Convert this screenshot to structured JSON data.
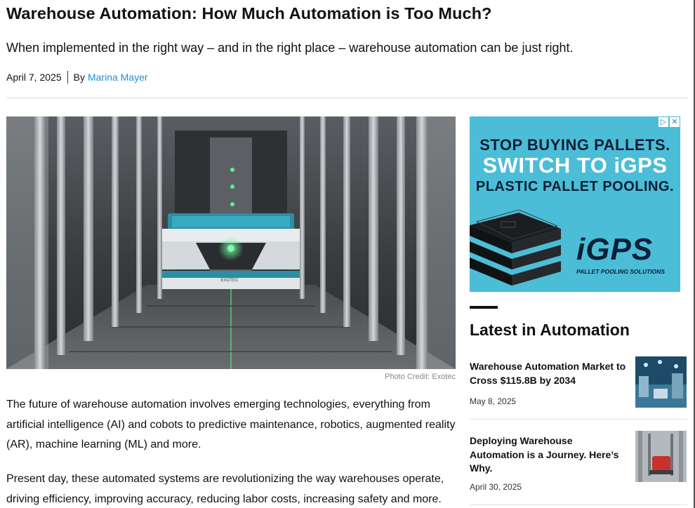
{
  "article": {
    "title": "Warehouse Automation: How Much Automation is Too Much?",
    "subtitle": "When implemented in the right way – and in the right place – warehouse automation can be just right.",
    "date": "April 7, 2025",
    "by_label": "By",
    "author": "Marina Mayer",
    "photo_credit": "Photo Credit: Exotec",
    "robot_label": "EXOTEC",
    "paragraphs": [
      "The future of warehouse automation involves emerging technologies, everything from artificial intelligence (AI) and cobots to predictive maintenance, robotics, augmented reality (AR), machine learning (ML) and more.",
      "Present day, these automated systems are revolutionizing the way warehouses operate, driving efficiency, improving accuracy, reducing labor costs, increasing safety and more."
    ]
  },
  "ad": {
    "line1": "STOP BUYING PALLETS.",
    "line2": "SWITCH TO iGPS",
    "line3": "PLASTIC PALLET POOLING.",
    "brand": "iGPS",
    "tagline": "PALLET POOLING SOLUTIONS",
    "adchoices_icon": "play-triangle-icon",
    "close_icon": "close-x-icon",
    "colors": {
      "background": "#4cbdd6",
      "navy": "#0c1f38"
    }
  },
  "sidebar": {
    "title": "Latest in Automation",
    "items": [
      {
        "title": "Warehouse Automation Market to Cross $115.8B by 2034",
        "date": "May 8, 2025"
      },
      {
        "title": "Deploying Warehouse Automation is a Journey. Here’s Why.",
        "date": "April 30, 2025"
      }
    ]
  },
  "colors": {
    "link": "#1f8fd6",
    "text": "#111111",
    "divider": "#dcdcdc"
  }
}
